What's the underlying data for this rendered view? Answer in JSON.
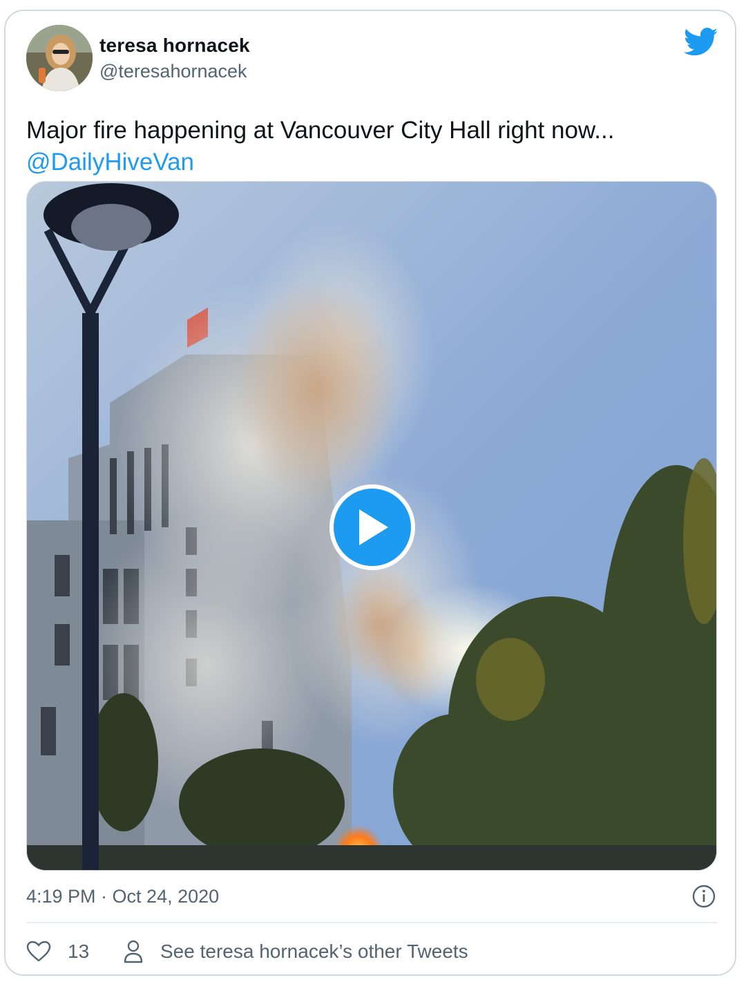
{
  "tweet": {
    "author": {
      "name": "teresa hornacek",
      "handle": "@teresahornacek"
    },
    "text": "Major fire happening at Vancouver City Hall right now...",
    "mention": "@DailyHiveVan",
    "timestamp": "4:19 PM · Oct 24, 2020",
    "likes": "13",
    "other_tweets_label": "See teresa hornacek’s other Tweets"
  },
  "icons": {
    "logo": "twitter-bird-icon",
    "play": "play-icon",
    "info": "info-icon",
    "like": "heart-icon",
    "profile": "person-icon"
  },
  "colors": {
    "accent": "#1d9bf0",
    "text": "#0f1419",
    "muted": "#536471",
    "border": "#cfd9de"
  }
}
